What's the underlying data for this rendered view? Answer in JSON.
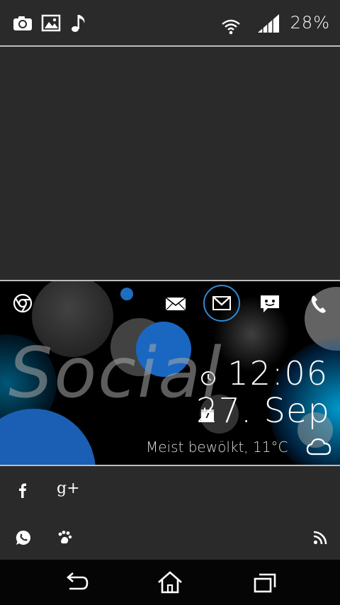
{
  "status_bar": {
    "battery_percent": "28%",
    "icons": [
      "camera-icon",
      "gallery-icon",
      "music-note-icon",
      "wifi-icon",
      "signal-icon"
    ]
  },
  "widget": {
    "title_art": "Social",
    "time": "12:06",
    "date": "27. Sep",
    "weather": "Meist bewölkt, 11°C",
    "icons": [
      "chrome-icon",
      "email-icon",
      "gmail-icon",
      "messaging-icon",
      "phone-icon",
      "clock-icon",
      "calendar-icon",
      "cloud-icon"
    ],
    "calendar_day": "7"
  },
  "shortcuts": [
    "facebook-icon",
    "google-plus-icon",
    "whatsapp-icon",
    "paw-icon",
    "rss-icon"
  ],
  "nav": [
    "back-icon",
    "home-icon",
    "recents-icon"
  ]
}
